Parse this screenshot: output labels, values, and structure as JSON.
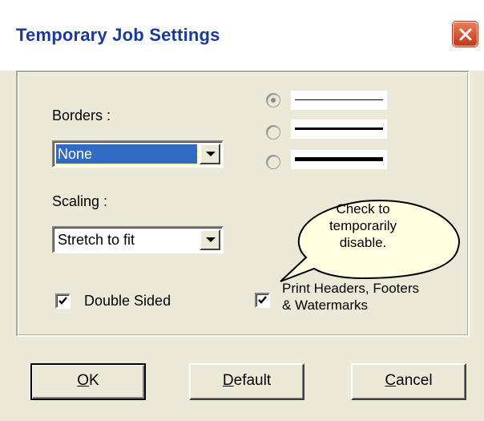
{
  "window": {
    "title": "Temporary Job Settings"
  },
  "borders": {
    "label": "Borders :",
    "selected": "None",
    "line_options": [
      {
        "name": "thin",
        "checked": true
      },
      {
        "name": "medium",
        "checked": false
      },
      {
        "name": "thick",
        "checked": false
      }
    ]
  },
  "scaling": {
    "label": "Scaling :",
    "selected": "Stretch to fit"
  },
  "double_sided": {
    "label": "Double Sided",
    "checked": true
  },
  "print_headers": {
    "line1": "Print Headers, Footers",
    "line2": "& Watermarks",
    "checked": true
  },
  "tooltip": {
    "line1": "Check to",
    "line2": "temporarily",
    "line3": "disable."
  },
  "buttons": {
    "ok": {
      "accel": "O",
      "rest": "K"
    },
    "default": {
      "accel": "D",
      "rest": "efault"
    },
    "cancel": {
      "accel": "C",
      "rest": "ancel"
    }
  },
  "colors": {
    "title": "#1a3a9a",
    "selection": "#316ac5",
    "dialog": "#ece9d8",
    "tooltip": "#ffffe1"
  }
}
